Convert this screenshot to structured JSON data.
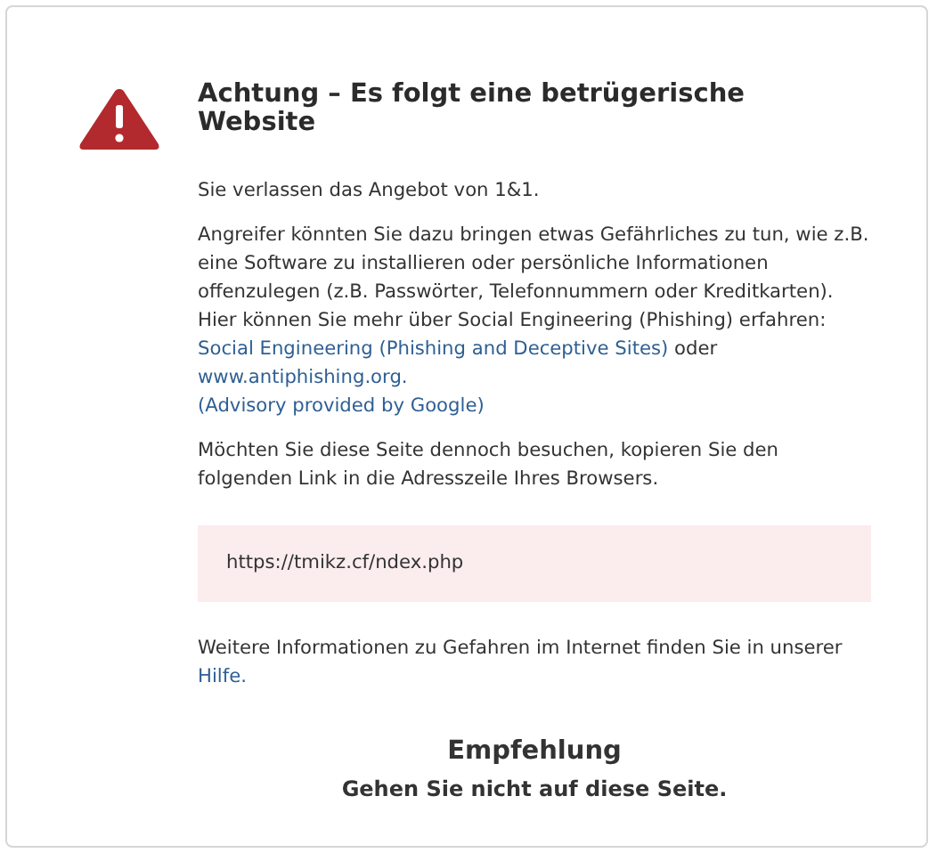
{
  "warning": {
    "title": "Achtung – Es folgt eine betrügerische Website",
    "paragraphs": [
      {
        "parts": [
          {
            "kind": "text",
            "text": "Sie verlassen das Angebot von 1&1."
          }
        ]
      },
      {
        "parts": [
          {
            "kind": "text",
            "text": "Angreifer könnten Sie dazu bringen etwas Gefährliches zu tun, wie z.B. eine Software zu installieren oder persönliche Informationen offenzulegen (z.B. Passwörter, Telefonnummern oder Kreditkarten). Hier können Sie mehr über Social Engineering (Phishing) erfahren: "
          },
          {
            "kind": "link",
            "text": "Social Engineering (Phishing and Deceptive Sites)"
          },
          {
            "kind": "text",
            "text": " oder "
          },
          {
            "kind": "link",
            "text": "www.antiphishing.org."
          },
          {
            "kind": "block_link",
            "text": "(Advisory provided by Google)"
          }
        ]
      },
      {
        "parts": [
          {
            "kind": "text",
            "text": "Möchten Sie diese Seite dennoch besuchen, kopieren Sie den folgenden Link in die Adresszeile Ihres Browsers."
          }
        ]
      }
    ],
    "url": "https://tmikz.cf/ndex.php",
    "help": {
      "parts": [
        {
          "kind": "text",
          "text": "Weitere Informationen zu Gefahren im Internet finden Sie in unserer "
        },
        {
          "kind": "link",
          "text": "Hilfe."
        }
      ]
    },
    "recommendation": {
      "heading": "Empfehlung",
      "text": "Gehen Sie nicht auf diese Seite."
    }
  }
}
